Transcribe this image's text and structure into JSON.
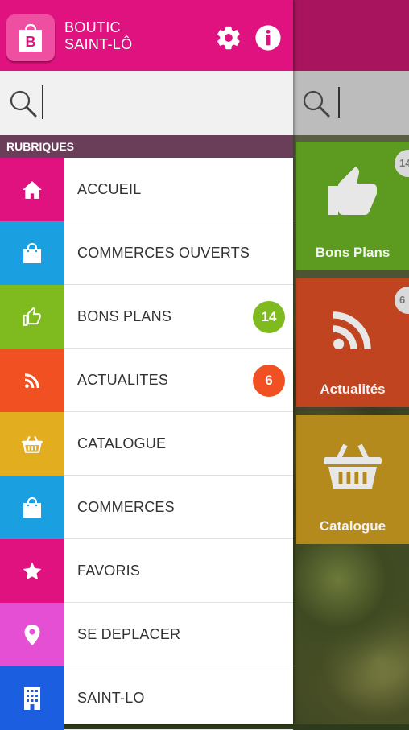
{
  "app": {
    "title_line1": "BOUTIC",
    "title_line2": "SAINT-LÔ"
  },
  "header_icons": {
    "settings": "gear-icon",
    "info": "info-icon",
    "logo": "shopping-bag-icon"
  },
  "search": {
    "placeholder": "",
    "value": ""
  },
  "section": {
    "title": "RUBRIQUES"
  },
  "menu": [
    {
      "label": "ACCUEIL",
      "icon": "home-icon",
      "color": "#e0127f"
    },
    {
      "label": "COMMERCES OUVERTS",
      "icon": "shopping-bag-icon",
      "color": "#1a9fe0"
    },
    {
      "label": "BONS PLANS",
      "icon": "thumbs-up-icon",
      "color": "#7fbb1e",
      "badge": "14",
      "badge_color": "#7fbb1e"
    },
    {
      "label": "ACTUALITES",
      "icon": "rss-icon",
      "color": "#f05022",
      "badge": "6",
      "badge_color": "#f05022"
    },
    {
      "label": "CATALOGUE",
      "icon": "basket-icon",
      "color": "#e2ad1e"
    },
    {
      "label": "COMMERCES",
      "icon": "shopping-bag-icon",
      "color": "#1a9fe0"
    },
    {
      "label": "FAVORIS",
      "icon": "star-icon",
      "color": "#e0127f"
    },
    {
      "label": "SE DEPLACER",
      "icon": "map-pin-icon",
      "color": "#e44fd4"
    },
    {
      "label": "SAINT-LO",
      "icon": "building-icon",
      "color": "#1b5fe0"
    }
  ],
  "background_tiles": [
    {
      "label": "Bons Plans",
      "badge": "14",
      "color": "#5d9b20"
    },
    {
      "label": "Actualités",
      "badge": "6",
      "color": "#c0441f"
    },
    {
      "label": "Catalogue",
      "color": "#b48a1c"
    }
  ]
}
